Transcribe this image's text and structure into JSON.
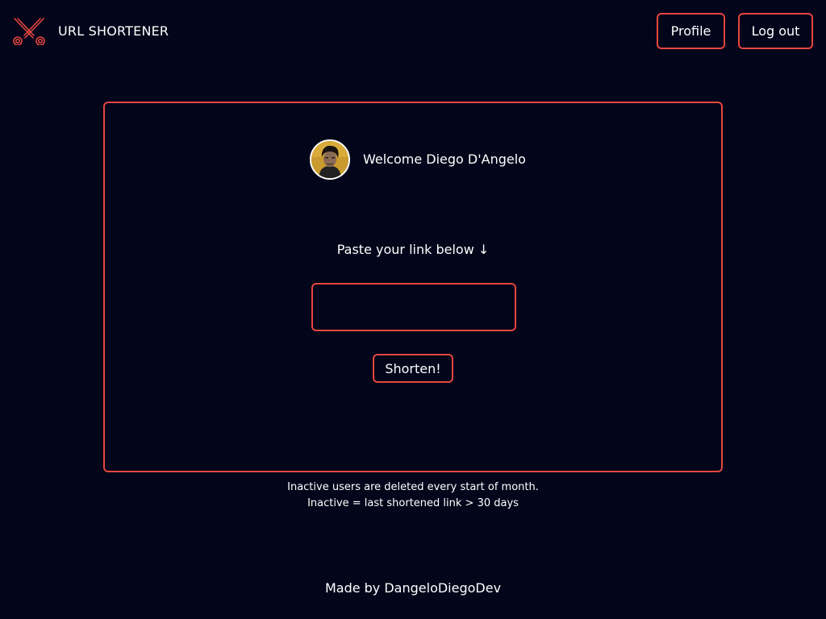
{
  "header": {
    "brand": "URL SHORTENER",
    "logo_icon": "scissors-icon",
    "profile_label": "Profile",
    "logout_label": "Log out"
  },
  "card": {
    "welcome": "Welcome Diego D'Angelo",
    "paste_label": "Paste your link below ↓",
    "link_input": {
      "value": "",
      "placeholder": ""
    },
    "shorten_label": "Shorten!"
  },
  "notes": {
    "line1": "Inactive users are deleted every start of month.",
    "line2": "Inactive = last shortened link > 30 days"
  },
  "footer": {
    "credit": "Made by DangeloDiegoDev"
  },
  "colors": {
    "background": "#03051a",
    "accent": "#e5463f",
    "text": "#ffffff"
  }
}
